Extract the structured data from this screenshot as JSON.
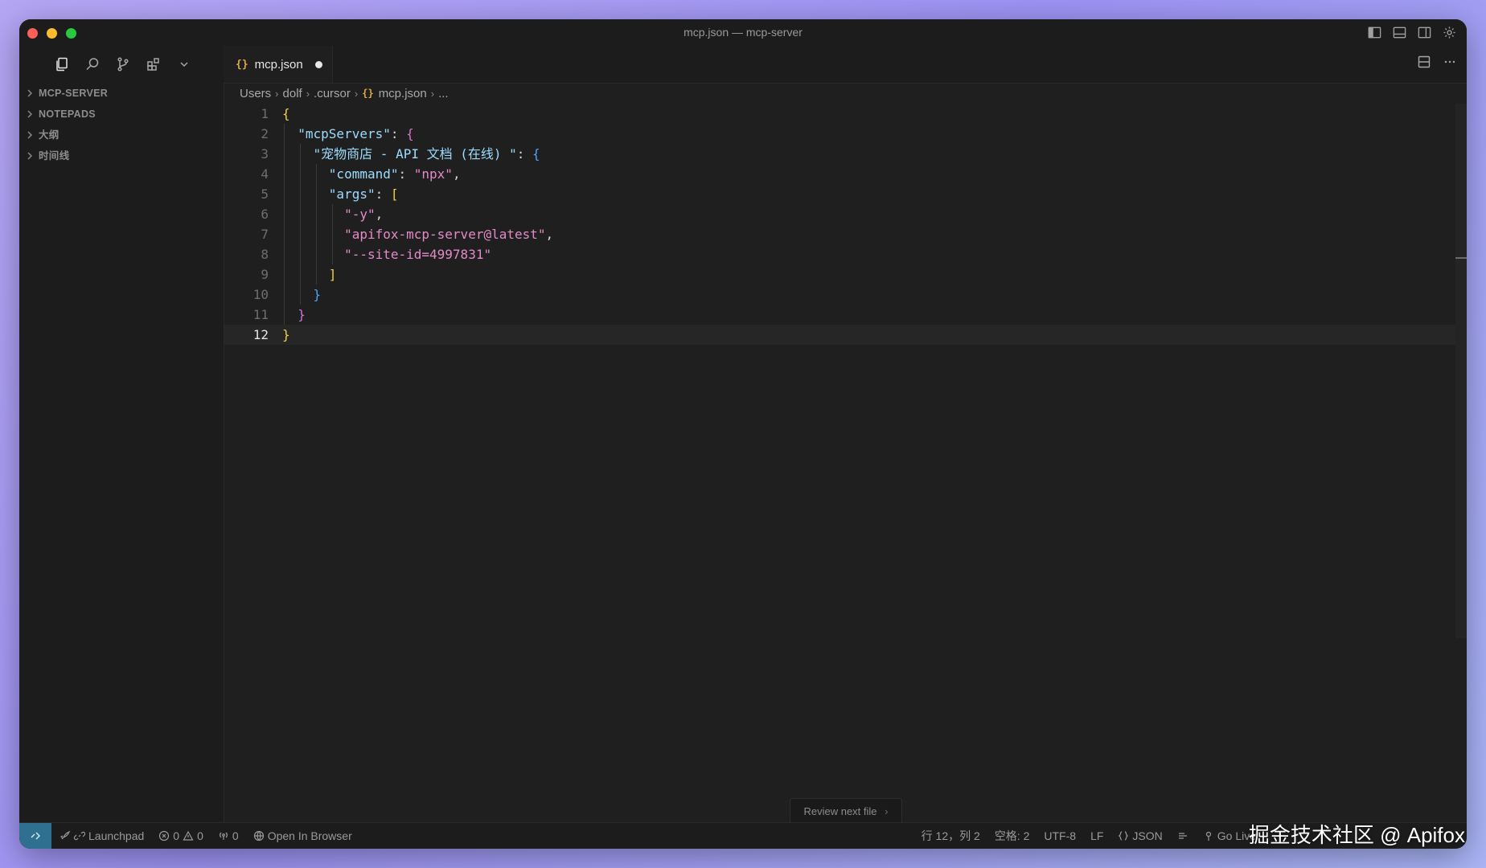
{
  "window": {
    "title": "mcp.json — mcp-server"
  },
  "sidebar": {
    "sections": [
      {
        "label": "MCP-SERVER"
      },
      {
        "label": "NOTEPADS"
      },
      {
        "label": "大纲"
      },
      {
        "label": "时间线"
      }
    ]
  },
  "tab": {
    "icon_glyph": "{}",
    "label": "mcp.json"
  },
  "breadcrumb": {
    "items": [
      "Users",
      "dolf",
      ".cursor"
    ],
    "file_icon": "{}",
    "file": "mcp.json",
    "more": "..."
  },
  "editor": {
    "line_numbers": [
      "1",
      "2",
      "3",
      "4",
      "5",
      "6",
      "7",
      "8",
      "9",
      "10",
      "11",
      "12"
    ],
    "tokens": {
      "brace_open": "{",
      "brace_close": "}",
      "bracket_open": "[",
      "bracket_close": "]",
      "colon": ": ",
      "comma": ",",
      "k_mcpServers": "\"mcpServers\"",
      "k_server": "\"宠物商店 - API 文档 (在线) \"",
      "k_command": "\"command\"",
      "v_command": "\"npx\"",
      "k_args": "\"args\"",
      "a1": "\"-y\"",
      "a2": "\"apifox-mcp-server@latest\"",
      "a3": "\"--site-id=4997831\""
    },
    "current_line": 12
  },
  "review_button": {
    "label": "Review next file",
    "chevron": "›"
  },
  "statusbar": {
    "launchpad": "Launchpad",
    "errors": "0",
    "warnings": "0",
    "ports": "0",
    "open_in_browser": "Open In Browser",
    "cursor_pos": "行 12，列 2",
    "spaces": "空格: 2",
    "encoding": "UTF-8",
    "eol": "LF",
    "language": "JSON",
    "go_live": "Go Live"
  },
  "watermark": "掘金技术社区 @ Apifox"
}
